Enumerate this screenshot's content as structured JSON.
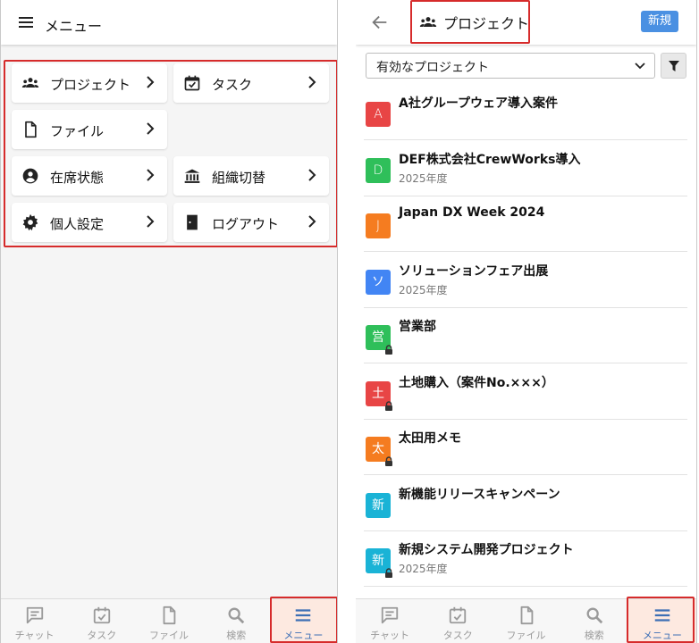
{
  "left_screen": {
    "header": {
      "title": "メニュー",
      "icon": "hamburger-icon"
    },
    "menu_items": [
      {
        "label": "プロジェクト",
        "icon": "people-icon"
      },
      {
        "label": "タスク",
        "icon": "calendar-check-icon"
      },
      {
        "label": "ファイル",
        "icon": "file-icon"
      },
      {
        "label": "在席状態",
        "icon": "account-circle-icon"
      },
      {
        "label": "組織切替",
        "icon": "bank-icon"
      },
      {
        "label": "個人設定",
        "icon": "gear-icon"
      },
      {
        "label": "ログアウト",
        "icon": "door-icon"
      }
    ],
    "bottom_nav": [
      {
        "label": "チャット",
        "icon": "chat-icon"
      },
      {
        "label": "タスク",
        "icon": "task-icon"
      },
      {
        "label": "ファイル",
        "icon": "file-icon"
      },
      {
        "label": "検索",
        "icon": "search-icon"
      },
      {
        "label": "メニュー",
        "icon": "menu-icon",
        "active": true
      }
    ]
  },
  "right_screen": {
    "header": {
      "title": "プロジェクト",
      "icon": "people-icon",
      "back_icon": "back-arrow-icon",
      "new_button": "新規"
    },
    "filter": {
      "selected": "有効なプロジェクト",
      "filter_icon": "funnel-icon"
    },
    "projects": [
      {
        "initial": "A",
        "name": "A社グループウェア導入案件",
        "sub": "",
        "color": "#e84545",
        "locked": false
      },
      {
        "initial": "D",
        "name": "DEF株式会社CrewWorks導入",
        "sub": "2025年度",
        "color": "#2fbf5a",
        "locked": false
      },
      {
        "initial": "J",
        "name": "Japan DX Week 2024",
        "sub": "",
        "color": "#f57c20",
        "locked": false
      },
      {
        "initial": "ソ",
        "name": "ソリューションフェア出展",
        "sub": "2025年度",
        "color": "#4285f4",
        "locked": false
      },
      {
        "initial": "営",
        "name": "営業部",
        "sub": "",
        "color": "#2fbf5a",
        "locked": true
      },
      {
        "initial": "土",
        "name": "土地購入（案件No.×××）",
        "sub": "",
        "color": "#e84545",
        "locked": true
      },
      {
        "initial": "太",
        "name": "太田用メモ",
        "sub": "",
        "color": "#f57c20",
        "locked": true
      },
      {
        "initial": "新",
        "name": "新機能リリースキャンペーン",
        "sub": "",
        "color": "#1ab3d6",
        "locked": false
      },
      {
        "initial": "新",
        "name": "新規システム開発プロジェクト",
        "sub": "2025年度",
        "color": "#1ab3d6",
        "locked": true
      }
    ],
    "bottom_nav": [
      {
        "label": "チャット",
        "icon": "chat-icon"
      },
      {
        "label": "タスク",
        "icon": "task-icon"
      },
      {
        "label": "ファイル",
        "icon": "file-icon"
      },
      {
        "label": "検索",
        "icon": "search-icon"
      },
      {
        "label": "メニュー",
        "icon": "menu-icon",
        "active": true
      }
    ]
  },
  "colors": {
    "highlight_frame": "#d62b2b",
    "new_button": "#4a90e2",
    "active_nav_bg": "#fde9e0",
    "active_nav_text": "#3d6fb5"
  }
}
